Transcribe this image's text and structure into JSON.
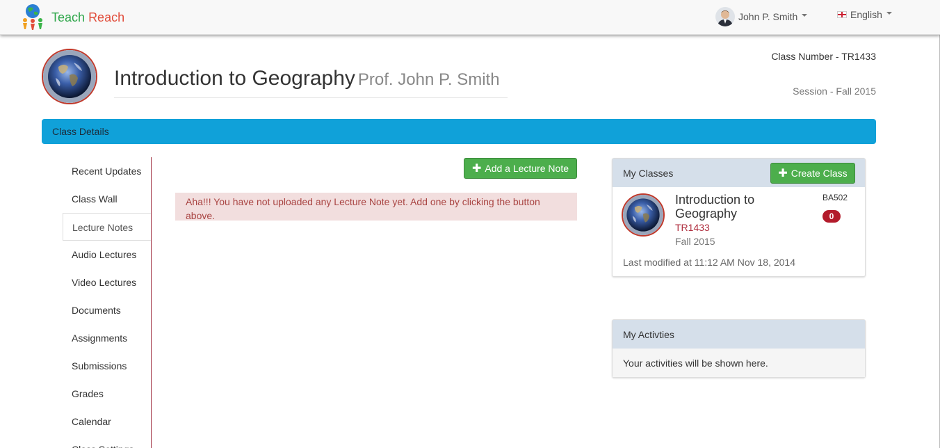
{
  "navbar": {
    "brand_part1": "Teach",
    "brand_part2": "Reach",
    "user_name": "John P. Smith",
    "language": "English"
  },
  "header": {
    "class_title": "Introduction to Geography",
    "professor": "Prof. John P. Smith",
    "class_number": "Class Number - TR1433",
    "session": "Session - Fall 2015"
  },
  "details_bar": {
    "label": "Class Details"
  },
  "sidebar": {
    "items": [
      {
        "label": "Recent Updates"
      },
      {
        "label": "Class Wall"
      },
      {
        "label": "Lecture Notes"
      },
      {
        "label": "Audio Lectures"
      },
      {
        "label": "Video Lectures"
      },
      {
        "label": "Documents"
      },
      {
        "label": "Assignments"
      },
      {
        "label": "Submissions"
      },
      {
        "label": "Grades"
      },
      {
        "label": "Calendar"
      },
      {
        "label": "Class Settings"
      }
    ]
  },
  "main": {
    "add_button": "Add a Lecture Note",
    "alert": "Aha!!! You have not uploaded any Lecture Note yet. Add one by clicking the button above."
  },
  "my_classes": {
    "heading": "My Classes",
    "create_button": "Create Class",
    "class": {
      "title": "Introduction to Geography",
      "code": "TR1433",
      "session": "Fall 2015",
      "id": "BA502",
      "badge": "0",
      "modified": "Last modified at 11:12 AM Nov 18, 2014"
    }
  },
  "activities": {
    "heading": "My Activties",
    "body": "Your activities will be shown here."
  },
  "colors": {
    "brand_green": "#2ea64a",
    "brand_red": "#e14c3a",
    "details_bar": "#10a1d9",
    "success_button": "#4cae4c",
    "alert_bg": "#f2dede",
    "alert_text": "#a94442",
    "badge": "#b31b2b"
  }
}
